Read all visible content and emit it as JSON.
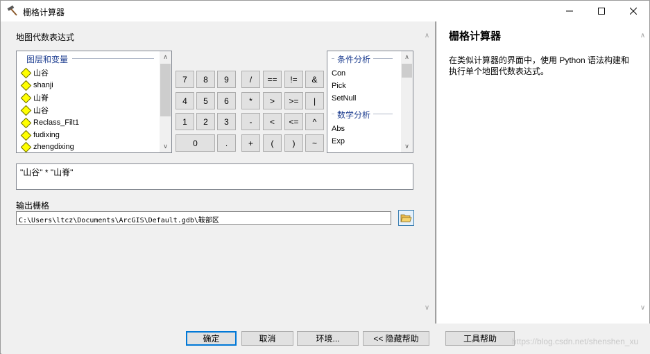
{
  "window": {
    "title": "栅格计算器",
    "controls": {
      "minimize": "—",
      "maximize": "☐",
      "close": "✕"
    }
  },
  "expression_panel": {
    "label": "地图代数表达式",
    "layers": {
      "header": "图层和变量",
      "items": [
        "山谷",
        "shanji",
        "山脊",
        "山谷",
        "Reclass_Filt1",
        "fudixing",
        "zhengdixing"
      ]
    },
    "functions": {
      "groups": [
        {
          "header": "条件分析",
          "items": [
            "Con",
            "Pick",
            "SetNull"
          ]
        },
        {
          "header": "数学分析",
          "items": [
            "Abs",
            "Exp"
          ]
        }
      ]
    },
    "keypad": [
      [
        "7",
        "8",
        "9",
        "/",
        "==",
        "!=",
        "&"
      ],
      [
        "4",
        "5",
        "6",
        "*",
        ">",
        ">=",
        "|"
      ],
      [
        "1",
        "2",
        "3",
        "-",
        "<",
        "<=",
        "^"
      ],
      [
        "0",
        ".",
        "+",
        "(",
        ")",
        "~"
      ]
    ],
    "expression": "\"山谷\" * \"山脊\""
  },
  "output": {
    "label": "输出栅格",
    "path": "C:\\Users\\ltcz\\Documents\\ArcGIS\\Default.gdb\\鞍部区"
  },
  "help_panel": {
    "title": "栅格计算器",
    "text": "在类似计算器的界面中，使用 Python 语法构建和执行单个地图代数表达式。"
  },
  "buttons": {
    "ok": "确定",
    "cancel": "取消",
    "environments": "环境...",
    "hide_help": "<< 隐藏帮助",
    "tool_help": "工具帮助"
  },
  "watermark": "https://blog.csdn.net/shenshen_xu"
}
